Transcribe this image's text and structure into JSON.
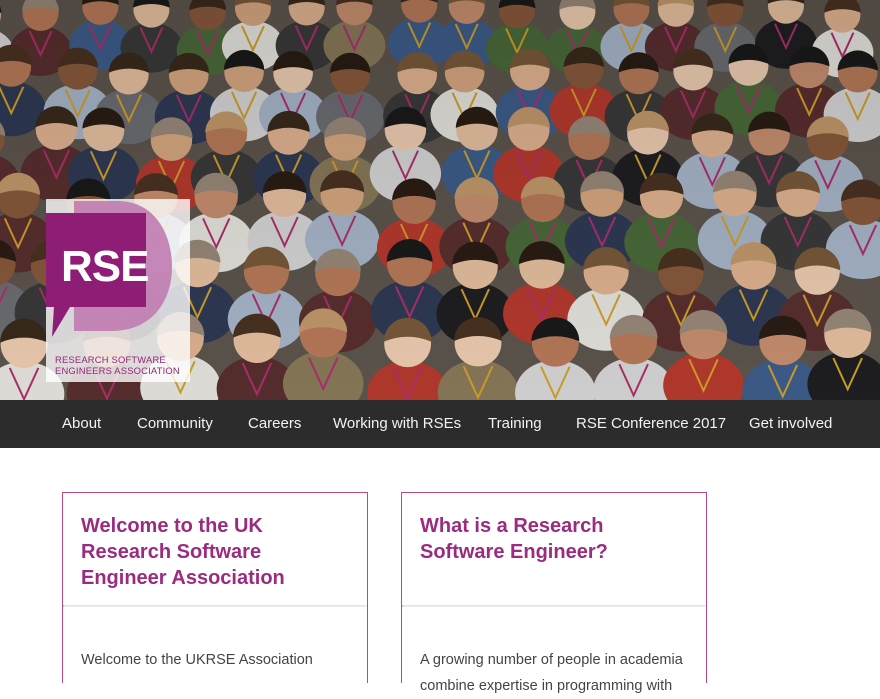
{
  "logo": {
    "letters": "RSE",
    "subtitle_line1": "RESEARCH SOFTWARE",
    "subtitle_line2": "ENGINEERS ASSOCIATION",
    "brand_color": "#8e1d76"
  },
  "nav": {
    "items": [
      {
        "label": "About"
      },
      {
        "label": "Community"
      },
      {
        "label": "Careers"
      },
      {
        "label": "Working with RSEs"
      },
      {
        "label": "Training"
      },
      {
        "label": "RSE Conference 2017"
      },
      {
        "label": "Get involved"
      }
    ],
    "background": "#2c2c2c"
  },
  "cards": [
    {
      "title": "Welcome to the UK Research Software Engineer Association",
      "text": "Welcome to the UKRSE Association"
    },
    {
      "title": "What is a Research Software Engineer?",
      "text": "A growing number of people in academia combine expertise in programming with"
    }
  ],
  "colors": {
    "accent": "#9b2b7f",
    "card_border": "#b9488f"
  }
}
